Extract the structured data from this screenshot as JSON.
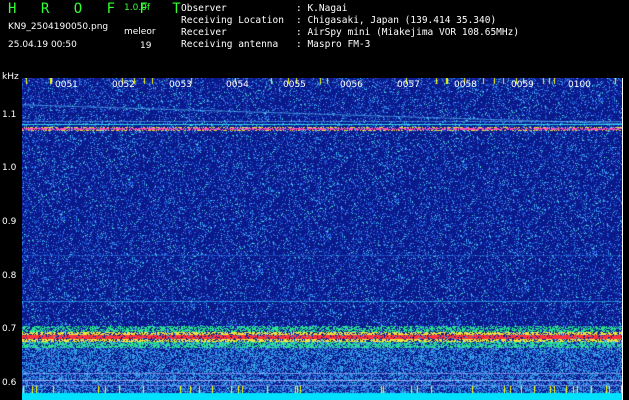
{
  "header": {
    "logo": "H R O F F T",
    "version": "1.0.0f",
    "filename": "KN9_2504190050.png",
    "timestamp": "25.04.19 00:50",
    "meteor_label": "meleor",
    "meteor_count": "19"
  },
  "info": [
    {
      "key": "Observer",
      "value": ": K.Nagai"
    },
    {
      "key": "Receiving Location",
      "value": ": Chigasaki, Japan (139.414 35.340)"
    },
    {
      "key": "Receiver",
      "value": ": AirSpy mini (Miakejima VOR 108.65MHz)"
    },
    {
      "key": "Receiving antenna",
      "value": ": Maspro FM-3"
    }
  ],
  "chart_data": {
    "type": "heatmap",
    "ylabel": "kHz",
    "y_ticks": [
      "1.1",
      "1.0",
      "0.9",
      "0.8",
      "0.7",
      "0.6"
    ],
    "x_ticks": [
      "0051",
      "0052",
      "0053",
      "0054",
      "0055",
      "0056",
      "0057",
      "0058",
      "0059",
      "0100"
    ],
    "ylim": [
      0.57,
      1.17
    ],
    "colors": {
      "background": "#0b1a8c",
      "noise": "#2a66d8",
      "strong": "#ff3a3a",
      "medium": "#33ffcc",
      "carrier": "#00ffff"
    }
  }
}
